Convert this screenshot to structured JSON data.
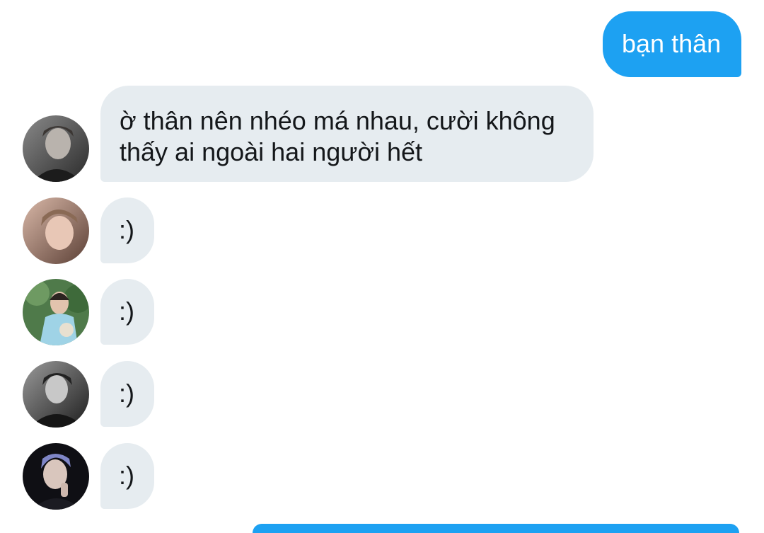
{
  "conversation": {
    "messages": [
      {
        "direction": "outgoing",
        "text": "bạn thân"
      },
      {
        "direction": "incoming",
        "text": "ờ thân nên nhéo má nhau, cười không thấy ai ngoài hai người hết",
        "avatar_icon": "user-avatar-icon"
      },
      {
        "direction": "incoming",
        "text": ":)",
        "avatar_icon": "user-avatar-icon"
      },
      {
        "direction": "incoming",
        "text": ":)",
        "avatar_icon": "user-avatar-icon"
      },
      {
        "direction": "incoming",
        "text": ":)",
        "avatar_icon": "user-avatar-icon"
      },
      {
        "direction": "incoming",
        "text": ":)",
        "avatar_icon": "user-avatar-icon"
      }
    ]
  },
  "colors": {
    "outgoing_bubble": "#1da1f2",
    "incoming_bubble": "#e6ecf0",
    "incoming_text": "#14171a",
    "outgoing_text": "#ffffff",
    "background": "#ffffff"
  }
}
